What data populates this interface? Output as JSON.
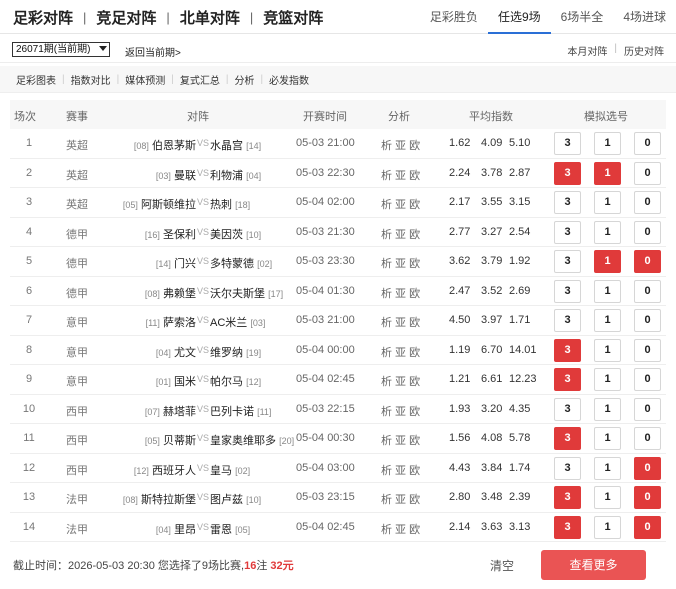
{
  "main_tabs": [
    "足彩对阵",
    "竞足对阵",
    "北单对阵",
    "竞篮对阵"
  ],
  "main_sep": "|",
  "sub_tabs": [
    "足彩胜负",
    "任选9场",
    "6场半全",
    "4场进球"
  ],
  "active_sub_tab": 1,
  "period": {
    "select_value": "26071期(当前期)",
    "back_label": "返回当前期>",
    "right_links": [
      "本月对阵",
      "历史对阵"
    ],
    "right_sep": "|"
  },
  "toolbar": {
    "items": [
      "足彩图表",
      "指数对比",
      "媒体预测",
      "复式汇总",
      "分析",
      "必发指数"
    ],
    "sep": "|"
  },
  "headers": {
    "num": "场次",
    "league": "赛事",
    "match": "对阵",
    "time": "开赛时间",
    "analysis": "分析",
    "odds": "平均指数",
    "picks": "模拟选号"
  },
  "pick_labels": [
    "3",
    "1",
    "0"
  ],
  "vs_label": "VS",
  "rows": [
    {
      "num": "1",
      "league": "英超",
      "home_rank": "[08]",
      "home": "伯恩茅斯",
      "away": "水晶宫",
      "away_rank": "[14]",
      "time": "05-03 21:00",
      "ana": "析 亚 欧",
      "o1": "1.62",
      "o2": "4.09",
      "o3": "5.10",
      "sel": [
        false,
        false,
        false
      ]
    },
    {
      "num": "2",
      "league": "英超",
      "home_rank": "[03]",
      "home": "曼联",
      "away": "利物浦",
      "away_rank": "[04]",
      "time": "05-03 22:30",
      "ana": "析 亚 欧",
      "o1": "2.24",
      "o2": "3.78",
      "o3": "2.87",
      "sel": [
        true,
        true,
        false
      ]
    },
    {
      "num": "3",
      "league": "英超",
      "home_rank": "[05]",
      "home": "阿斯顿维拉",
      "away": "热刺",
      "away_rank": "[18]",
      "time": "05-04 02:00",
      "ana": "析 亚 欧",
      "o1": "2.17",
      "o2": "3.55",
      "o3": "3.15",
      "sel": [
        false,
        false,
        false
      ]
    },
    {
      "num": "4",
      "league": "德甲",
      "home_rank": "[16]",
      "home": "圣保利",
      "away": "美因茨",
      "away_rank": "[10]",
      "time": "05-03 21:30",
      "ana": "析 亚 欧",
      "o1": "2.77",
      "o2": "3.27",
      "o3": "2.54",
      "sel": [
        false,
        false,
        false
      ]
    },
    {
      "num": "5",
      "league": "德甲",
      "home_rank": "[14]",
      "home": "门兴",
      "away": "多特蒙德",
      "away_rank": "[02]",
      "time": "05-03 23:30",
      "ana": "析 亚 欧",
      "o1": "3.62",
      "o2": "3.79",
      "o3": "1.92",
      "sel": [
        false,
        true,
        true
      ]
    },
    {
      "num": "6",
      "league": "德甲",
      "home_rank": "[08]",
      "home": "弗赖堡",
      "away": "沃尔夫斯堡",
      "away_rank": "[17]",
      "time": "05-04 01:30",
      "ana": "析 亚 欧",
      "o1": "2.47",
      "o2": "3.52",
      "o3": "2.69",
      "sel": [
        false,
        false,
        false
      ]
    },
    {
      "num": "7",
      "league": "意甲",
      "home_rank": "[11]",
      "home": "萨索洛",
      "away": "AC米兰",
      "away_rank": "[03]",
      "time": "05-03 21:00",
      "ana": "析 亚 欧",
      "o1": "4.50",
      "o2": "3.97",
      "o3": "1.71",
      "sel": [
        false,
        false,
        false
      ]
    },
    {
      "num": "8",
      "league": "意甲",
      "home_rank": "[04]",
      "home": "尤文",
      "away": "维罗纳",
      "away_rank": "[19]",
      "time": "05-04 00:00",
      "ana": "析 亚 欧",
      "o1": "1.19",
      "o2": "6.70",
      "o3": "14.01",
      "sel": [
        true,
        false,
        false
      ]
    },
    {
      "num": "9",
      "league": "意甲",
      "home_rank": "[01]",
      "home": "国米",
      "away": "帕尔马",
      "away_rank": "[12]",
      "time": "05-04 02:45",
      "ana": "析 亚 欧",
      "o1": "1.21",
      "o2": "6.61",
      "o3": "12.23",
      "sel": [
        true,
        false,
        false
      ]
    },
    {
      "num": "10",
      "league": "西甲",
      "home_rank": "[07]",
      "home": "赫塔菲",
      "away": "巴列卡诺",
      "away_rank": "[11]",
      "time": "05-03 22:15",
      "ana": "析 亚 欧",
      "o1": "1.93",
      "o2": "3.20",
      "o3": "4.35",
      "sel": [
        false,
        false,
        false
      ]
    },
    {
      "num": "11",
      "league": "西甲",
      "home_rank": "[05]",
      "home": "贝蒂斯",
      "away": "皇家奥维耶多",
      "away_rank": "[20]",
      "time": "05-04 00:30",
      "ana": "析 亚 欧",
      "o1": "1.56",
      "o2": "4.08",
      "o3": "5.78",
      "sel": [
        true,
        false,
        false
      ]
    },
    {
      "num": "12",
      "league": "西甲",
      "home_rank": "[12]",
      "home": "西班牙人",
      "away": "皇马",
      "away_rank": "[02]",
      "time": "05-04 03:00",
      "ana": "析 亚 欧",
      "o1": "4.43",
      "o2": "3.84",
      "o3": "1.74",
      "sel": [
        false,
        false,
        true
      ]
    },
    {
      "num": "13",
      "league": "法甲",
      "home_rank": "[08]",
      "home": "斯特拉斯堡",
      "away": "图卢兹",
      "away_rank": "[10]",
      "time": "05-03 23:15",
      "ana": "析 亚 欧",
      "o1": "2.80",
      "o2": "3.48",
      "o3": "2.39",
      "sel": [
        true,
        false,
        true
      ]
    },
    {
      "num": "14",
      "league": "法甲",
      "home_rank": "[04]",
      "home": "里昂",
      "away": "雷恩",
      "away_rank": "[05]",
      "time": "05-04 02:45",
      "ana": "析 亚 欧",
      "o1": "2.14",
      "o2": "3.63",
      "o3": "3.13",
      "sel": [
        true,
        false,
        true
      ]
    }
  ],
  "footer": {
    "prefix": "截止时间：2026-05-03 20:30 您选择了9场比赛,",
    "count": "16",
    "mid": "注 ",
    "amount": "32元",
    "clear_label": "清空",
    "more_label": "查看更多"
  },
  "colors": {
    "accent_red": "#e03a3a",
    "active_tab_underline": "#2a6fd6"
  }
}
